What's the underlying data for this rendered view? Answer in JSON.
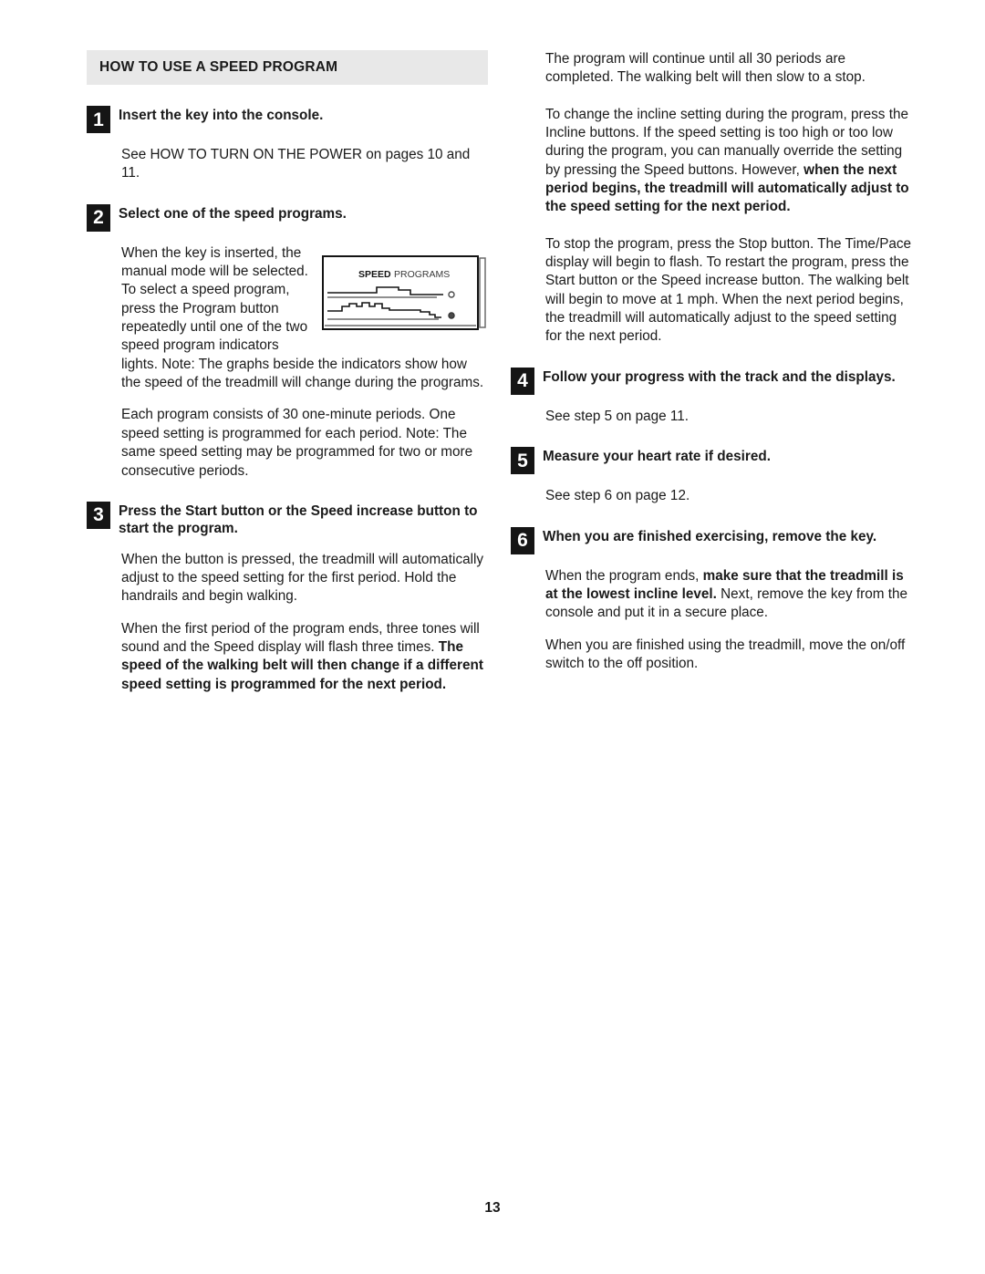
{
  "page": {
    "number": "13",
    "header_bg": "#e8e8e8",
    "badge_bg": "#151515",
    "text_color": "#1a1a1a"
  },
  "left_column": {
    "section_header": "HOW TO USE A SPEED PROGRAM",
    "steps": [
      {
        "number": "1",
        "title": "Insert the key into the console.",
        "paragraphs": [
          "See HOW TO TURN ON THE POWER on pages 10 and 11."
        ]
      },
      {
        "number": "2",
        "title": "Select one of the speed programs.",
        "paragraphs": [
          "When the key is inserted, the manual mode will be selected. To select a speed program, press the Program button repeatedly until one of the two speed program indicators lights. Note: The graphs beside the indicators show how the speed of the treadmill will change during the programs.",
          "Each program consists of 30 one-minute periods. One speed setting is programmed for each period. Note: The same speed setting may be programmed for two or more consecutive periods."
        ]
      },
      {
        "number": "3",
        "title": "Press the Start button or the Speed increase button to start the program.",
        "paragraphs": [
          "When the button is pressed, the treadmill will automatically adjust to the speed setting for the first period. Hold the handrails and begin walking."
        ],
        "paragraph_rich": {
          "plain_start": "When the first period of the program ends, three tones will sound and the Speed display will flash three times. ",
          "bold_part": "The speed of the walking belt will then change if a different speed setting is programmed for the next period."
        }
      }
    ],
    "figure": {
      "label_bold": "SPEED",
      "label_regular": "PROGRAMS",
      "indicator_top": "open-circle-indicator",
      "indicator_bottom": "filled-circle-indicator"
    }
  },
  "right_column": {
    "paragraphs_top": [
      "The program will continue until all 30 periods are completed. The walking belt will then slow to a stop."
    ],
    "incline_paragraph": {
      "plain_start": "To change the incline setting during the program, press the Incline buttons. If the speed setting is too high or too low during the program, you can manually override the setting by pressing the Speed buttons. However, ",
      "bold_part": "when the next period begins, the treadmill will automatically adjust to the speed setting for the next period."
    },
    "stop_paragraph": "To stop the program, press the Stop button. The Time/Pace display will begin to flash. To restart the program, press the Start button or the Speed increase button. The walking belt will begin to move at 1 mph. When the next period begins, the treadmill will automatically adjust to the speed setting for the next period.",
    "steps": [
      {
        "number": "4",
        "title": "Follow your progress with the track and the displays.",
        "paragraph": "See step 5 on page 11."
      },
      {
        "number": "5",
        "title": "Measure your heart rate if desired.",
        "paragraph": "See step 6 on page 12."
      },
      {
        "number": "6",
        "title": "When you are finished exercising, remove the key.",
        "paragraph_rich": {
          "plain_start": "When the program ends, ",
          "bold_part": "make sure that the treadmill is at the lowest incline level.",
          "plain_end": " Next, remove the key from the console and put it in a secure place."
        },
        "final_paragraph": "When you are finished using the treadmill, move the on/off switch to the off position."
      }
    ]
  }
}
